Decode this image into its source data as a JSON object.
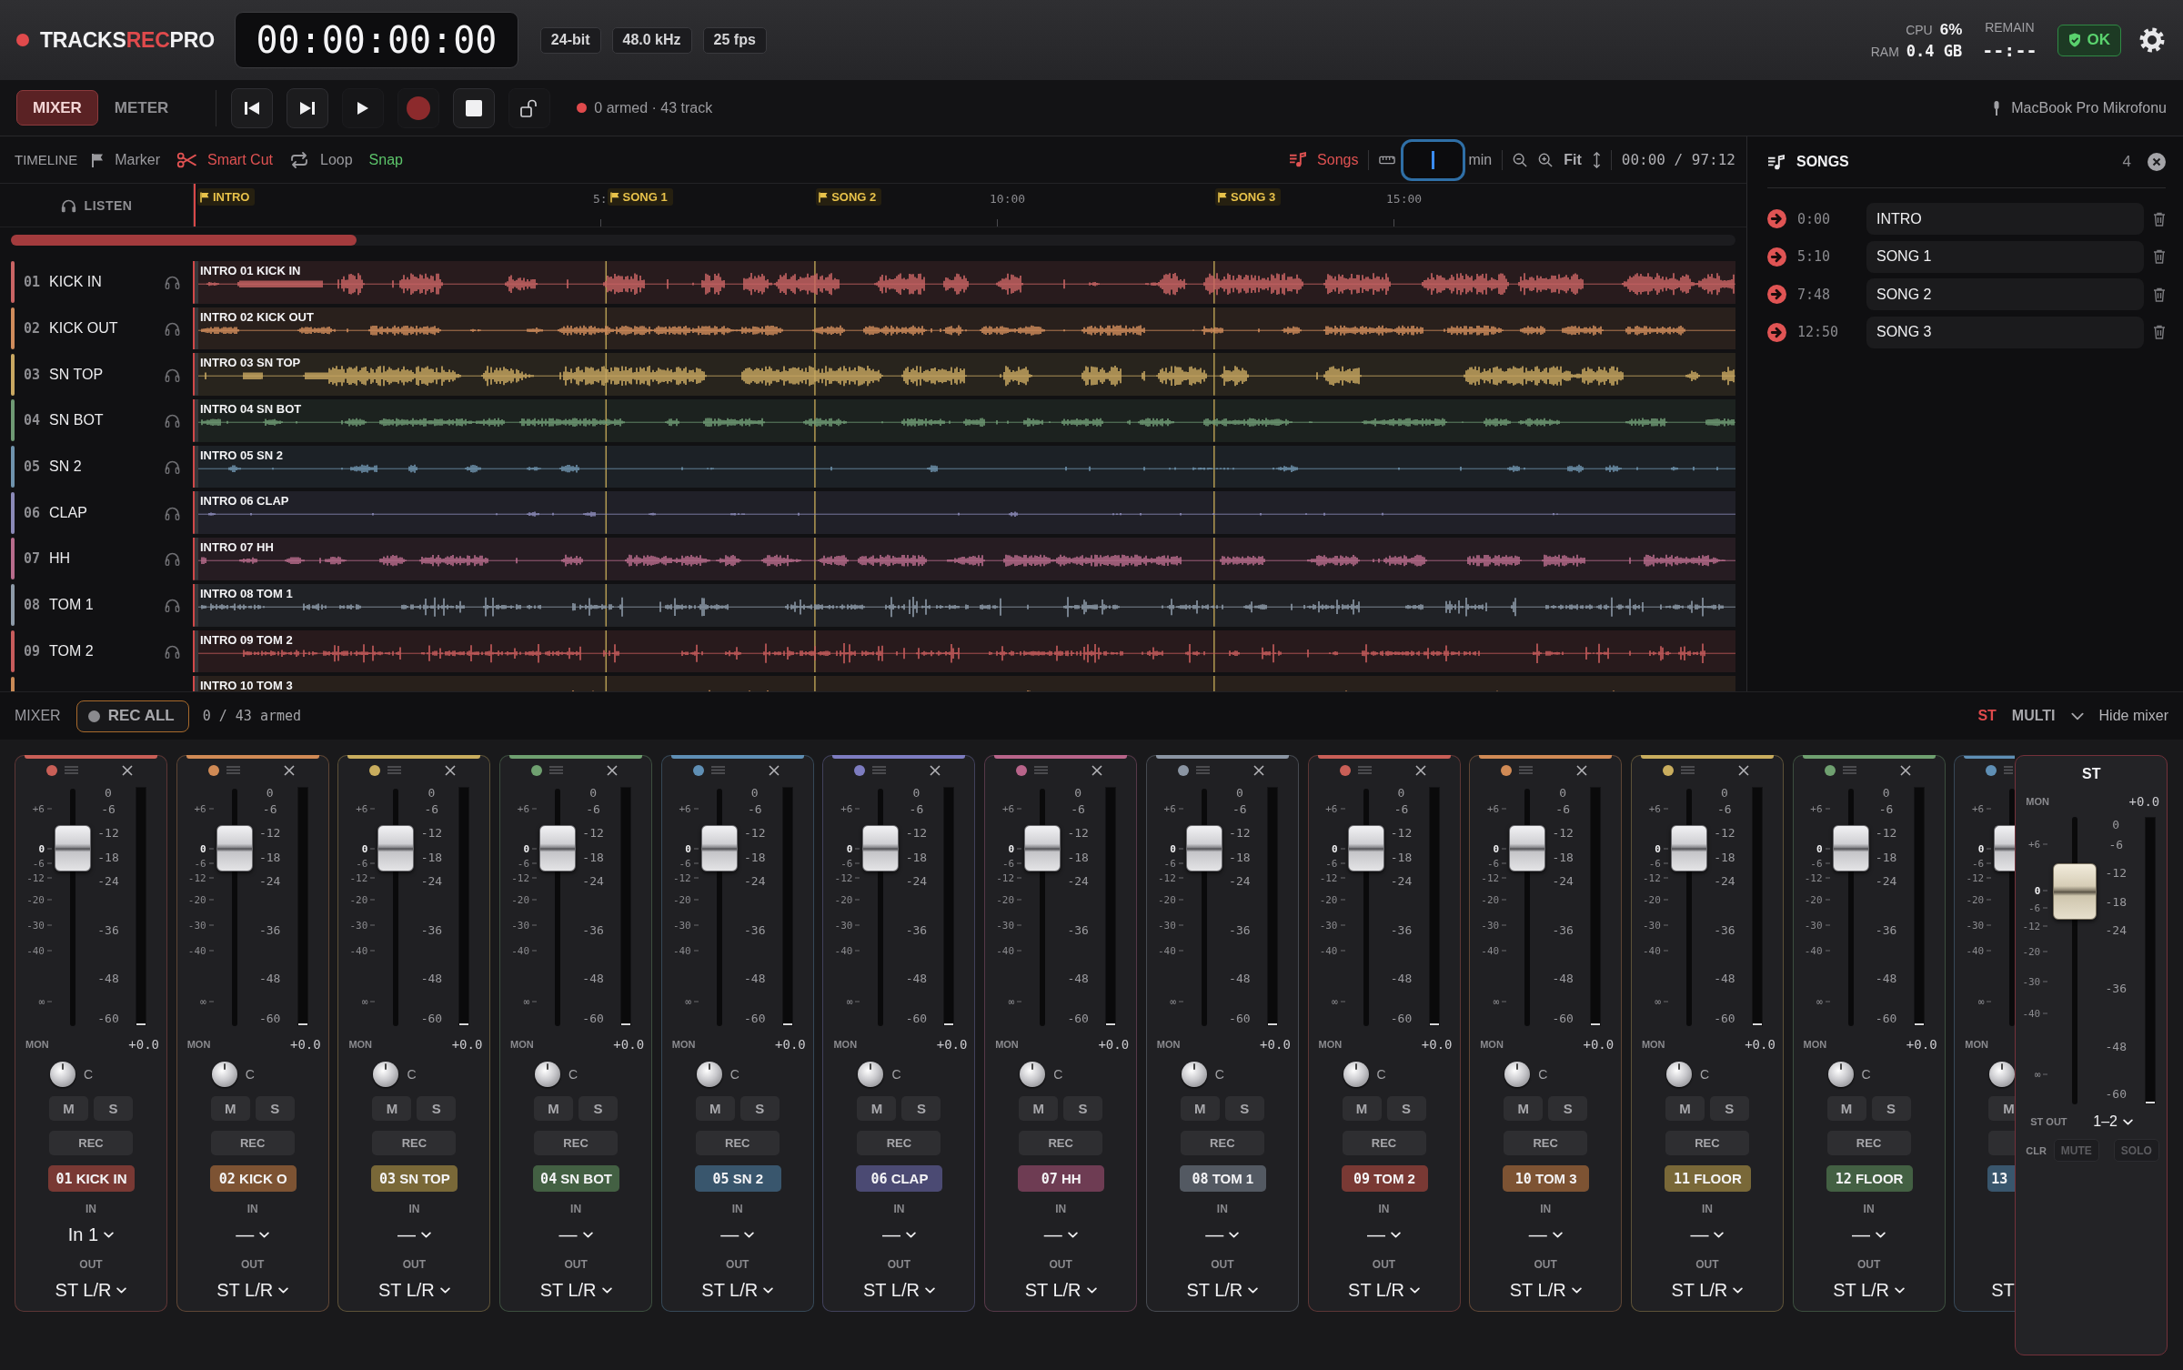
{
  "header": {
    "logo": {
      "prefix": "TRACKS",
      "highlight": "REC",
      "suffix": "PRO"
    },
    "timecode": "00:00:00:00",
    "format_badges": [
      "24-bit",
      "48.0 kHz",
      "25 fps"
    ],
    "cpu": {
      "label": "CPU",
      "value": "6%"
    },
    "ram": {
      "label": "RAM",
      "value": "0.4 GB"
    },
    "remain": {
      "label": "REMAIN",
      "value": "--:--"
    },
    "status": "OK"
  },
  "toolbar": {
    "views": [
      {
        "label": "MIXER",
        "selected": true
      },
      {
        "label": "METER",
        "selected": false
      }
    ],
    "armed_status": "0 armed · 43 track",
    "input_device": "MacBook Pro Mikrofonu"
  },
  "timeline": {
    "title": "TIMELINE",
    "tools": [
      {
        "kind": "marker",
        "label": "Marker",
        "on": false
      },
      {
        "kind": "smart_cut",
        "label": "Smart Cut",
        "on": true
      },
      {
        "kind": "loop",
        "label": "Loop",
        "on": false
      },
      {
        "kind": "snap",
        "label": "Snap",
        "on": true
      }
    ],
    "songs_toggle": {
      "label": "Songs",
      "on": true
    },
    "zoom_unit": "min",
    "fit": "Fit",
    "position": "00:00 / 97:12",
    "listen": "LISTEN",
    "ticks": [
      "5:",
      "10:00",
      "15:00"
    ],
    "markers": [
      "INTRO",
      "SONG 1",
      "SONG 2",
      "SONG 3"
    ],
    "tracks": [
      {
        "number": "01",
        "name": "KICK IN",
        "clip": "INTRO 01 KICK IN",
        "color": "#c96464"
      },
      {
        "number": "02",
        "name": "KICK OUT",
        "clip": "INTRO 02 KICK OUT",
        "color": "#d08c5c"
      },
      {
        "number": "03",
        "name": "SN TOP",
        "clip": "INTRO 03 SN TOP",
        "color": "#c9a862"
      },
      {
        "number": "04",
        "name": "SN BOT",
        "clip": "INTRO 04 SN BOT",
        "color": "#6f9a74"
      },
      {
        "number": "05",
        "name": "SN 2",
        "clip": "INTRO 05 SN 2",
        "color": "#6f93ad"
      },
      {
        "number": "06",
        "name": "CLAP",
        "clip": "INTRO 06 CLAP",
        "color": "#8b8ab8"
      },
      {
        "number": "07",
        "name": "HH",
        "clip": "INTRO 07 HH",
        "color": "#b86c8c"
      },
      {
        "number": "08",
        "name": "TOM 1",
        "clip": "INTRO 08 TOM 1",
        "color": "#8d9aa8"
      },
      {
        "number": "09",
        "name": "TOM 2",
        "clip": "INTRO 09 TOM 2",
        "color": "#c75c5c"
      },
      {
        "clip": "INTRO 10 TOM 3",
        "color": "#c98a56"
      }
    ]
  },
  "songs_panel": {
    "title": "SONGS",
    "count": "4",
    "songs": [
      {
        "time": "0:00",
        "name": "INTRO"
      },
      {
        "time": "5:10",
        "name": "SONG 1"
      },
      {
        "time": "7:48",
        "name": "SONG 2"
      },
      {
        "time": "12:50",
        "name": "SONG 3"
      }
    ]
  },
  "mixer": {
    "title": "MIXER",
    "rec_all": "REC ALL",
    "armed": "0 / 43 armed",
    "modes": [
      {
        "label": "ST",
        "selected": true
      },
      {
        "label": "MULTI",
        "selected": false
      }
    ],
    "hide": "Hide mixer",
    "strips": [
      {
        "kind": "full",
        "color": "#c95f57",
        "fader_scale": [
          "+6",
          "0",
          "-6",
          "-12",
          "-20",
          "-30",
          "-40",
          "∞"
        ],
        "meter_scale": [
          "0",
          "-6",
          "-12",
          "-18",
          "-24",
          "-36",
          "-48",
          "-60"
        ],
        "fader": {
          "level": 0.75
        },
        "meter": {
          "level": 0
        },
        "mon": "MON",
        "gain": "+0.0",
        "pan": "C",
        "mute": "M",
        "solo": "S",
        "rec": "REC",
        "number": "01",
        "name": "KICK IN",
        "in_label": "IN",
        "input": "In 1",
        "out_label": "OUT",
        "output": "ST L/R"
      },
      {
        "kind": "full",
        "color": "#d08a55",
        "fader_scale": [
          "+6",
          "0",
          "-6",
          "-12",
          "-20",
          "-30",
          "-40",
          "∞"
        ],
        "meter_scale": [
          "0",
          "-6",
          "-12",
          "-18",
          "-24",
          "-36",
          "-48",
          "-60"
        ],
        "fader": {
          "level": 0.75
        },
        "meter": {
          "level": 0
        },
        "mon": "MON",
        "gain": "+0.0",
        "pan": "C",
        "mute": "M",
        "solo": "S",
        "rec": "REC",
        "number": "02",
        "name": "KICK O",
        "in_label": "IN",
        "input": "—",
        "out_label": "OUT",
        "output": "ST L/R"
      },
      {
        "kind": "full",
        "color": "#c9ad5e",
        "fader_scale": [
          "+6",
          "0",
          "-6",
          "-12",
          "-20",
          "-30",
          "-40",
          "∞"
        ],
        "meter_scale": [
          "0",
          "-6",
          "-12",
          "-18",
          "-24",
          "-36",
          "-48",
          "-60"
        ],
        "fader": {
          "level": 0.75
        },
        "meter": {
          "level": 0
        },
        "mon": "MON",
        "gain": "+0.0",
        "pan": "C",
        "mute": "M",
        "solo": "S",
        "rec": "REC",
        "number": "03",
        "name": "SN TOP",
        "in_label": "IN",
        "input": "—",
        "out_label": "OUT",
        "output": "ST L/R"
      },
      {
        "kind": "full",
        "color": "#6fa070",
        "fader_scale": [
          "+6",
          "0",
          "-6",
          "-12",
          "-20",
          "-30",
          "-40",
          "∞"
        ],
        "meter_scale": [
          "0",
          "-6",
          "-12",
          "-18",
          "-24",
          "-36",
          "-48",
          "-60"
        ],
        "fader": {
          "level": 0.75
        },
        "meter": {
          "level": 0
        },
        "mon": "MON",
        "gain": "+0.0",
        "pan": "C",
        "mute": "M",
        "solo": "S",
        "rec": "REC",
        "number": "04",
        "name": "SN BOT",
        "in_label": "IN",
        "input": "—",
        "out_label": "OUT",
        "output": "ST L/R"
      },
      {
        "kind": "full",
        "color": "#5f8fb5",
        "fader_scale": [
          "+6",
          "0",
          "-6",
          "-12",
          "-20",
          "-30",
          "-40",
          "∞"
        ],
        "meter_scale": [
          "0",
          "-6",
          "-12",
          "-18",
          "-24",
          "-36",
          "-48",
          "-60"
        ],
        "fader": {
          "level": 0.75
        },
        "meter": {
          "level": 0
        },
        "mon": "MON",
        "gain": "+0.0",
        "pan": "C",
        "mute": "M",
        "solo": "S",
        "rec": "REC",
        "number": "05",
        "name": "SN 2",
        "in_label": "IN",
        "input": "—",
        "out_label": "OUT",
        "output": "ST L/R"
      },
      {
        "kind": "full",
        "color": "#7d7cc0",
        "fader_scale": [
          "+6",
          "0",
          "-6",
          "-12",
          "-20",
          "-30",
          "-40",
          "∞"
        ],
        "meter_scale": [
          "0",
          "-6",
          "-12",
          "-18",
          "-24",
          "-36",
          "-48",
          "-60"
        ],
        "fader": {
          "level": 0.75
        },
        "meter": {
          "level": 0
        },
        "mon": "MON",
        "gain": "+0.0",
        "pan": "C",
        "mute": "M",
        "solo": "S",
        "rec": "REC",
        "number": "06",
        "name": "CLAP",
        "in_label": "IN",
        "input": "—",
        "out_label": "OUT",
        "output": "ST L/R"
      },
      {
        "kind": "full",
        "color": "#b8648a",
        "fader_scale": [
          "+6",
          "0",
          "-6",
          "-12",
          "-20",
          "-30",
          "-40",
          "∞"
        ],
        "meter_scale": [
          "0",
          "-6",
          "-12",
          "-18",
          "-24",
          "-36",
          "-48",
          "-60"
        ],
        "fader": {
          "level": 0.75
        },
        "meter": {
          "level": 0
        },
        "mon": "MON",
        "gain": "+0.0",
        "pan": "C",
        "mute": "M",
        "solo": "S",
        "rec": "REC",
        "number": "07",
        "name": "HH",
        "in_label": "IN",
        "input": "—",
        "out_label": "OUT",
        "output": "ST L/R"
      },
      {
        "kind": "full",
        "color": "#8b95a3",
        "fader_scale": [
          "+6",
          "0",
          "-6",
          "-12",
          "-20",
          "-30",
          "-40",
          "∞"
        ],
        "meter_scale": [
          "0",
          "-6",
          "-12",
          "-18",
          "-24",
          "-36",
          "-48",
          "-60"
        ],
        "fader": {
          "level": 0.75
        },
        "meter": {
          "level": 0
        },
        "mon": "MON",
        "gain": "+0.0",
        "pan": "C",
        "mute": "M",
        "solo": "S",
        "rec": "REC",
        "number": "08",
        "name": "TOM 1",
        "in_label": "IN",
        "input": "—",
        "out_label": "OUT",
        "output": "ST L/R"
      },
      {
        "kind": "full",
        "color": "#c95f57",
        "fader_scale": [
          "+6",
          "0",
          "-6",
          "-12",
          "-20",
          "-30",
          "-40",
          "∞"
        ],
        "meter_scale": [
          "0",
          "-6",
          "-12",
          "-18",
          "-24",
          "-36",
          "-48",
          "-60"
        ],
        "fader": {
          "level": 0.75
        },
        "meter": {
          "level": 0
        },
        "mon": "MON",
        "gain": "+0.0",
        "pan": "C",
        "mute": "M",
        "solo": "S",
        "rec": "REC",
        "number": "09",
        "name": "TOM 2",
        "in_label": "IN",
        "input": "—",
        "out_label": "OUT",
        "output": "ST L/R"
      },
      {
        "kind": "full",
        "color": "#d08a55",
        "fader_scale": [
          "+6",
          "0",
          "-6",
          "-12",
          "-20",
          "-30",
          "-40",
          "∞"
        ],
        "meter_scale": [
          "0",
          "-6",
          "-12",
          "-18",
          "-24",
          "-36",
          "-48",
          "-60"
        ],
        "fader": {
          "level": 0.75
        },
        "meter": {
          "level": 0
        },
        "mon": "MON",
        "gain": "+0.0",
        "pan": "C",
        "mute": "M",
        "solo": "S",
        "rec": "REC",
        "number": "10",
        "name": "TOM 3",
        "in_label": "IN",
        "input": "—",
        "out_label": "OUT",
        "output": "ST L/R"
      },
      {
        "kind": "full",
        "color": "#c9ad5e",
        "fader_scale": [
          "+6",
          "0",
          "-6",
          "-12",
          "-20",
          "-30",
          "-40",
          "∞"
        ],
        "meter_scale": [
          "0",
          "-6",
          "-12",
          "-18",
          "-24",
          "-36",
          "-48",
          "-60"
        ],
        "fader": {
          "level": 0.75
        },
        "meter": {
          "level": 0
        },
        "mon": "MON",
        "gain": "+0.0",
        "pan": "C",
        "mute": "M",
        "solo": "S",
        "rec": "REC",
        "number": "11",
        "name": "FLOOR",
        "in_label": "IN",
        "input": "—",
        "out_label": "OUT",
        "output": "ST L/R"
      },
      {
        "kind": "full",
        "color": "#6fa070",
        "fader_scale": [
          "+6",
          "0",
          "-6",
          "-12",
          "-20",
          "-30",
          "-40",
          "∞"
        ],
        "meter_scale": [
          "0",
          "-6",
          "-12",
          "-18",
          "-24",
          "-36",
          "-48",
          "-60"
        ],
        "fader": {
          "level": 0.75
        },
        "meter": {
          "level": 0
        },
        "mon": "MON",
        "gain": "+0.0",
        "pan": "C",
        "mute": "M",
        "solo": "S",
        "rec": "REC",
        "number": "12",
        "name": "FLOOR",
        "in_label": "IN",
        "input": "—",
        "out_label": "OUT",
        "output": "ST L/R"
      },
      {
        "kind": "partial",
        "color": "#5f8fb5",
        "fader_scale": [
          "+6",
          "0",
          "-6",
          "-12",
          "-20",
          "-30",
          "-40",
          "∞"
        ],
        "fader": {
          "level": 0.75
        },
        "mon": "MON",
        "mute": "M",
        "number": "13",
        "output": "ST"
      }
    ],
    "master": {
      "title": "ST",
      "mon": "MON",
      "gain": "+0.0",
      "fader_scale": [
        "+6",
        "0",
        "-6",
        "-12",
        "-20",
        "-30",
        "-40",
        "∞"
      ],
      "meter_scale": [
        "0",
        "-6",
        "-12",
        "-18",
        "-24",
        "-36",
        "-48",
        "-60"
      ],
      "fader": {
        "level": 0.74
      },
      "meter": {
        "level": 0
      },
      "out_label": "ST OUT",
      "output": "1–2",
      "clear": "CLR",
      "buttons": [
        {
          "label": "MUTE",
          "disabled": true
        },
        {
          "label": "SOLO",
          "disabled": true
        }
      ]
    }
  }
}
